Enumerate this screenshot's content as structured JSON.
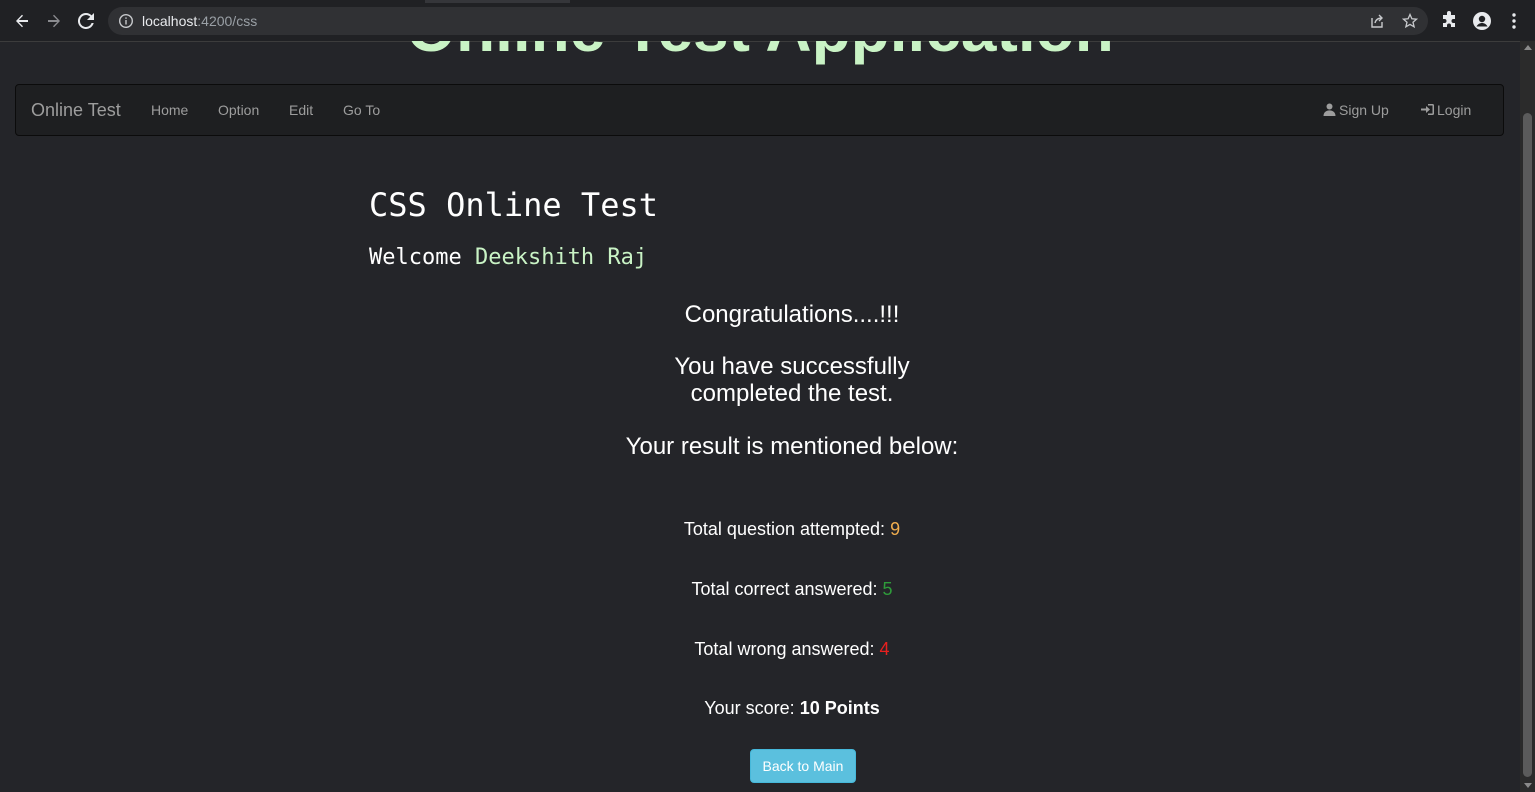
{
  "browser": {
    "url_host": "localhost",
    "url_path": ":4200/css",
    "icons": [
      "back-icon",
      "forward-icon",
      "reload-icon",
      "site-info-icon",
      "share-icon",
      "bookmark-star-icon",
      "extensions-icon",
      "profile-icon",
      "menu-icon"
    ]
  },
  "page": {
    "app_title": "Online Test Application",
    "navbar": {
      "brand": "Online Test",
      "links": [
        "Home",
        "Option",
        "Edit",
        "Go To"
      ],
      "signup_label": "Sign Up",
      "login_label": "Login"
    },
    "test_title": "CSS Online Test",
    "welcome_prefix": "Welcome",
    "user_name": "Deekshith Raj",
    "congrats": "Congratulations....!!!",
    "success_line1": "You have successfully",
    "success_line2": "completed the test.",
    "result_intro": "Your result is mentioned below:",
    "stats": {
      "attempted_label": "Total question attempted:",
      "attempted_value": "9",
      "correct_label": "Total correct answered:",
      "correct_value": "5",
      "wrong_label": "Total wrong answered:",
      "wrong_value": "4",
      "score_label": "Your score:",
      "score_value": "10 Points"
    },
    "back_button": "Back to Main"
  },
  "colors": {
    "background": "#242529",
    "title_green": "#c9f3c5",
    "attempted": "#f0ad4e",
    "correct": "#2e9b3a",
    "wrong": "#e8201f",
    "button": "#5bc0de"
  }
}
